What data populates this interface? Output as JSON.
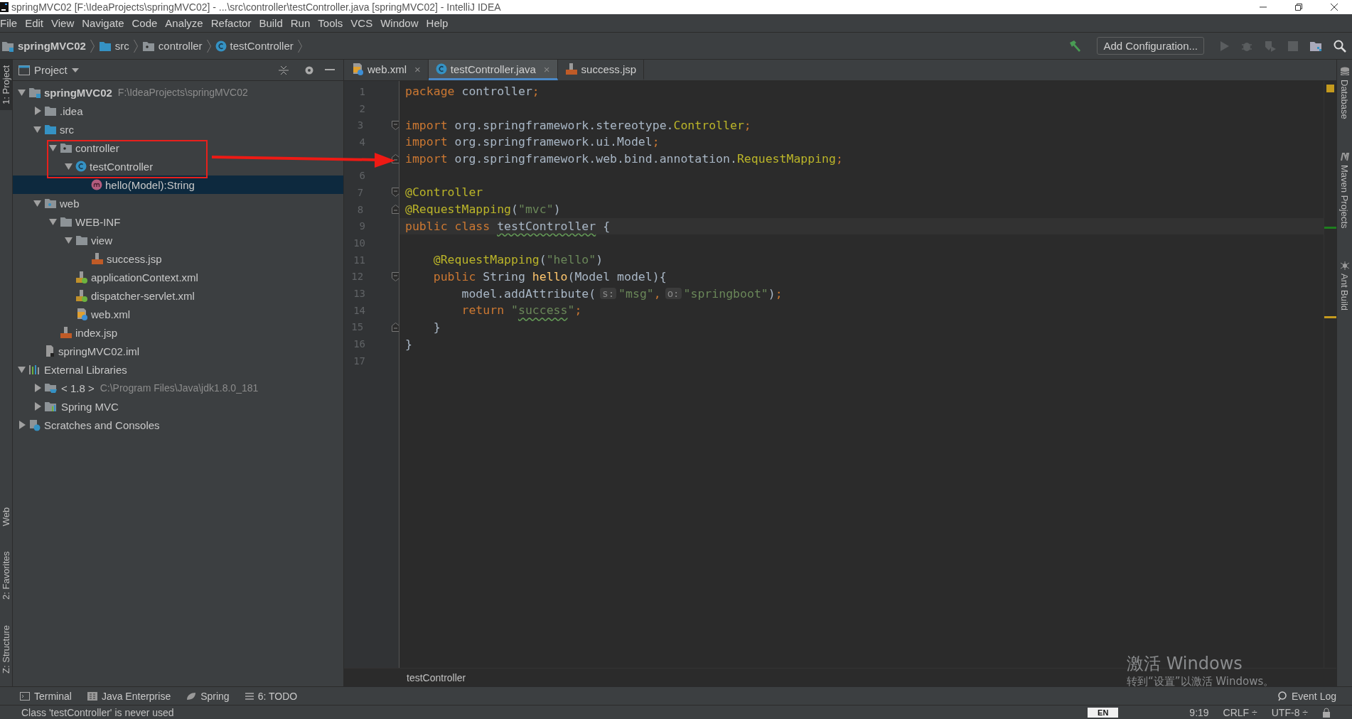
{
  "window": {
    "title": "springMVC02 [F:\\IdeaProjects\\springMVC02] - ...\\src\\controller\\testController.java [springMVC02] - IntelliJ IDEA"
  },
  "menu": [
    "File",
    "Edit",
    "View",
    "Navigate",
    "Code",
    "Analyze",
    "Refactor",
    "Build",
    "Run",
    "Tools",
    "VCS",
    "Window",
    "Help"
  ],
  "breadcrumbs": [
    {
      "label": "springMVC02",
      "kind": "module"
    },
    {
      "label": "src",
      "kind": "source-folder"
    },
    {
      "label": "controller",
      "kind": "package"
    },
    {
      "label": "testController",
      "kind": "class"
    }
  ],
  "run_config": {
    "label": "Add Configuration..."
  },
  "left_tool_windows": {
    "top": [
      {
        "label": "1: Project",
        "selected": true
      }
    ],
    "bottom": [
      {
        "label": "Web",
        "selected": false
      },
      {
        "label": "2: Favorites",
        "selected": false
      },
      {
        "label": "Z: Structure",
        "selected": false
      }
    ]
  },
  "project_panel": {
    "title": "Project",
    "tree": [
      {
        "label": "springMVC02",
        "detail": "F:\\IdeaProjects\\springMVC02",
        "kind": "module",
        "expanded": true,
        "selected": false,
        "children": [
          {
            "label": ".idea",
            "kind": "folder",
            "expanded": false,
            "selected": false
          },
          {
            "label": "src",
            "kind": "source-folder",
            "expanded": true,
            "selected": false,
            "children": [
              {
                "label": "controller",
                "kind": "package",
                "expanded": true,
                "selected": false,
                "children": [
                  {
                    "label": "testController",
                    "kind": "class",
                    "expanded": true,
                    "selected": false,
                    "children": [
                      {
                        "label": "hello(Model):String",
                        "kind": "method",
                        "selected": true
                      }
                    ]
                  }
                ]
              }
            ]
          },
          {
            "label": "web",
            "kind": "web-folder",
            "expanded": true,
            "selected": false,
            "children": [
              {
                "label": "WEB-INF",
                "kind": "folder",
                "expanded": true,
                "selected": false,
                "children": [
                  {
                    "label": "view",
                    "kind": "folder",
                    "expanded": true,
                    "selected": false,
                    "children": [
                      {
                        "label": "success.jsp",
                        "kind": "jsp",
                        "selected": false
                      }
                    ]
                  },
                  {
                    "label": "applicationContext.xml",
                    "kind": "spring-xml",
                    "selected": false
                  },
                  {
                    "label": "dispatcher-servlet.xml",
                    "kind": "spring-xml",
                    "selected": false
                  },
                  {
                    "label": "web.xml",
                    "kind": "web-xml",
                    "selected": false
                  }
                ]
              },
              {
                "label": "index.jsp",
                "kind": "jsp",
                "selected": false
              }
            ]
          },
          {
            "label": "springMVC02.iml",
            "kind": "iml",
            "selected": false
          }
        ]
      },
      {
        "label": "External Libraries",
        "kind": "libraries",
        "expanded": true,
        "selected": false,
        "children": [
          {
            "label": "< 1.8 >",
            "detail": "C:\\Program Files\\Java\\jdk1.8.0_181",
            "kind": "jdk",
            "expanded": false,
            "selected": false
          },
          {
            "label": "Spring MVC",
            "kind": "library",
            "expanded": false,
            "selected": false
          }
        ]
      },
      {
        "label": "Scratches and Consoles",
        "kind": "scratches",
        "expanded": false,
        "selected": false
      }
    ]
  },
  "editor": {
    "tabs": [
      {
        "label": "web.xml",
        "kind": "web-xml",
        "selected": false,
        "close": "×"
      },
      {
        "label": "testController.java",
        "kind": "class",
        "selected": true,
        "close": "×"
      },
      {
        "label": "success.jsp",
        "kind": "jsp",
        "selected": false
      }
    ],
    "lines": [
      {
        "number": "1",
        "tokens": [
          {
            "text": "package ",
            "kind": "keyword"
          },
          {
            "text": "controller",
            "kind": "plain"
          },
          {
            "text": ";",
            "kind": "keyword"
          }
        ]
      },
      {
        "number": "2"
      },
      {
        "number": "3",
        "fold_start": true,
        "tokens": [
          {
            "text": "import ",
            "kind": "keyword"
          },
          {
            "text": "org.springframework.stereotype.",
            "kind": "plain"
          },
          {
            "text": "Controller",
            "kind": "type"
          },
          {
            "text": ";",
            "kind": "keyword"
          }
        ]
      },
      {
        "number": "4",
        "tokens": [
          {
            "text": "import ",
            "kind": "keyword"
          },
          {
            "text": "org.springframework.ui.Model",
            "kind": "plain"
          },
          {
            "text": ";",
            "kind": "keyword"
          }
        ]
      },
      {
        "fold_end": true,
        "tokens": [
          {
            "text": "import ",
            "kind": "keyword"
          },
          {
            "text": "org.springframework.web.bind.annotation.",
            "kind": "plain"
          },
          {
            "text": "RequestMapping",
            "kind": "type"
          },
          {
            "text": ";",
            "kind": "keyword"
          }
        ]
      },
      {
        "number": "6"
      },
      {
        "number": "7",
        "fold_start": true,
        "tokens": [
          {
            "text": "@Controller",
            "kind": "annotation"
          }
        ]
      },
      {
        "number": "8",
        "fold_end": true,
        "tokens": [
          {
            "text": "@RequestMapping",
            "kind": "annotation"
          },
          {
            "text": "(",
            "kind": "plain"
          },
          {
            "text": "\"mvc\"",
            "kind": "string"
          },
          {
            "text": ")",
            "kind": "plain"
          }
        ]
      },
      {
        "number": "9",
        "current": true,
        "tokens": [
          {
            "text": "public class ",
            "kind": "keyword"
          },
          {
            "text": "testController",
            "kind": "plain",
            "warning": true
          },
          {
            "text": " {",
            "kind": "plain"
          }
        ]
      },
      {
        "number": "10"
      },
      {
        "number": "11",
        "tokens": [
          {
            "text": "    @RequestMapping",
            "kind": "annotation"
          },
          {
            "text": "(",
            "kind": "plain"
          },
          {
            "text": "\"hello\"",
            "kind": "string"
          },
          {
            "text": ")",
            "kind": "plain"
          }
        ]
      },
      {
        "number": "12",
        "fold_start": true,
        "tokens": [
          {
            "text": "    public ",
            "kind": "keyword"
          },
          {
            "text": "String ",
            "kind": "plain"
          },
          {
            "text": "hello",
            "kind": "method"
          },
          {
            "text": "(Model model){",
            "kind": "plain"
          }
        ]
      },
      {
        "number": "13",
        "tokens": [
          {
            "text": "        model.addAttribute(",
            "kind": "plain"
          },
          {
            "text": "s:",
            "kind": "hint"
          },
          {
            "text": "\"msg\"",
            "kind": "string"
          },
          {
            "text": ",",
            "kind": "keyword"
          },
          {
            "text": "o:",
            "kind": "hint"
          },
          {
            "text": "\"springboot\"",
            "kind": "string"
          },
          {
            "text": ")",
            "kind": "plain"
          },
          {
            "text": ";",
            "kind": "keyword"
          }
        ]
      },
      {
        "number": "14",
        "tokens": [
          {
            "text": "        return ",
            "kind": "keyword"
          },
          {
            "text": "\"",
            "kind": "string"
          },
          {
            "text": "success",
            "kind": "string",
            "warning": true
          },
          {
            "text": "\"",
            "kind": "string"
          },
          {
            "text": ";",
            "kind": "keyword"
          }
        ]
      },
      {
        "number": "15",
        "fold_end": true,
        "tokens": [
          {
            "text": "    }",
            "kind": "plain"
          }
        ]
      },
      {
        "number": "16",
        "tokens": [
          {
            "text": "}",
            "kind": "plain"
          }
        ]
      },
      {
        "number": "17"
      }
    ],
    "breadcrumb": "testController"
  },
  "right_tool_windows": [
    {
      "label": "Database",
      "kind": "database"
    },
    {
      "label": "Maven Projects",
      "kind": "maven"
    },
    {
      "label": "Ant Build",
      "kind": "ant"
    }
  ],
  "bottom_tools": [
    {
      "label": "Terminal",
      "kind": "terminal"
    },
    {
      "label": "Java Enterprise",
      "kind": "enterprise"
    },
    {
      "label": "Spring",
      "kind": "spring"
    },
    {
      "label": "6: TODO",
      "kind": "todo"
    }
  ],
  "event_log": "Event Log",
  "status_bar": {
    "message": "Class 'testController' is never used",
    "ime": "EN",
    "position": "9:19",
    "line_separator": "CRLF ÷",
    "encoding": "UTF-8 ÷"
  },
  "annotation": {
    "kind": "box-and-arrow"
  },
  "activation_notice": {
    "title": "激活 Windows",
    "subtitle": "转到“设置”以激活 Windows。"
  }
}
